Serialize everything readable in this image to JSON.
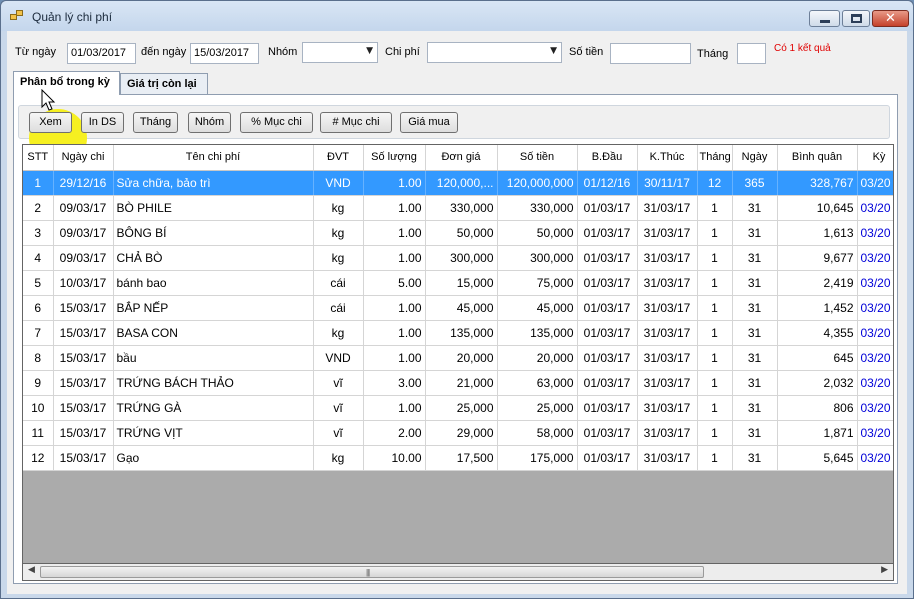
{
  "window": {
    "title": "Quản lý chi phí"
  },
  "filters": {
    "from_label": "Từ ngày",
    "from_value": "01/03/2017",
    "to_label": "đến ngày",
    "to_value": "15/03/2017",
    "group_label": "Nhóm",
    "group_value": "",
    "expense_label": "Chi phí",
    "expense_value": "",
    "amount_label": "Số tiền",
    "amount_value": "",
    "month_label": "Tháng",
    "month_value": "",
    "result_note": "Có 1 kết quả"
  },
  "tabs": [
    "Phân bổ trong kỳ",
    "Giá trị còn lại"
  ],
  "toolbar": {
    "view": "Xem",
    "print_list": "In DS",
    "month": "Tháng",
    "group": "Nhóm",
    "pct_category": "% Mục chi",
    "num_category": "# Mục chi",
    "purchase_price": "Giá mua"
  },
  "grid": {
    "columns": [
      "STT",
      "Ngày chi",
      "Tên chi phí",
      "ĐVT",
      "Số lượng",
      "Đơn giá",
      "Số tiền",
      "B.Đầu",
      "K.Thúc",
      "Tháng",
      "Ngày",
      "Bình quân",
      "Kỳ"
    ],
    "rows": [
      [
        "1",
        "29/12/16",
        "Sửa chữa, bảo trì",
        "VND",
        "1.00",
        "120,000,...",
        "120,000,000",
        "01/12/16",
        "30/11/17",
        "12",
        "365",
        "328,767",
        "03/20"
      ],
      [
        "2",
        "09/03/17",
        "BÒ PHILE",
        "kg",
        "1.00",
        "330,000",
        "330,000",
        "01/03/17",
        "31/03/17",
        "1",
        "31",
        "10,645",
        "03/20"
      ],
      [
        "3",
        "09/03/17",
        "BÔNG BÍ",
        "kg",
        "1.00",
        "50,000",
        "50,000",
        "01/03/17",
        "31/03/17",
        "1",
        "31",
        "1,613",
        "03/20"
      ],
      [
        "4",
        "09/03/17",
        "CHẢ BÒ",
        "kg",
        "1.00",
        "300,000",
        "300,000",
        "01/03/17",
        "31/03/17",
        "1",
        "31",
        "9,677",
        "03/20"
      ],
      [
        "5",
        "10/03/17",
        "bánh bao",
        "cái",
        "5.00",
        "15,000",
        "75,000",
        "01/03/17",
        "31/03/17",
        "1",
        "31",
        "2,419",
        "03/20"
      ],
      [
        "6",
        "15/03/17",
        "BẮP NẾP",
        "cái",
        "1.00",
        "45,000",
        "45,000",
        "01/03/17",
        "31/03/17",
        "1",
        "31",
        "1,452",
        "03/20"
      ],
      [
        "7",
        "15/03/17",
        "BASA CON",
        "kg",
        "1.00",
        "135,000",
        "135,000",
        "01/03/17",
        "31/03/17",
        "1",
        "31",
        "4,355",
        "03/20"
      ],
      [
        "8",
        "15/03/17",
        "bầu",
        "VND",
        "1.00",
        "20,000",
        "20,000",
        "01/03/17",
        "31/03/17",
        "1",
        "31",
        "645",
        "03/20"
      ],
      [
        "9",
        "15/03/17",
        "TRỨNG BÁCH THẢO",
        "vĩ",
        "3.00",
        "21,000",
        "63,000",
        "01/03/17",
        "31/03/17",
        "1",
        "31",
        "2,032",
        "03/20"
      ],
      [
        "10",
        "15/03/17",
        "TRỨNG GÀ",
        "vĩ",
        "1.00",
        "25,000",
        "25,000",
        "01/03/17",
        "31/03/17",
        "1",
        "31",
        "806",
        "03/20"
      ],
      [
        "11",
        "15/03/17",
        "TRỨNG VỊT",
        "vĩ",
        "2.00",
        "29,000",
        "58,000",
        "01/03/17",
        "31/03/17",
        "1",
        "31",
        "1,871",
        "03/20"
      ],
      [
        "12",
        "15/03/17",
        "Gạo",
        "kg",
        "10.00",
        "17,500",
        "175,000",
        "01/03/17",
        "31/03/17",
        "1",
        "31",
        "5,645",
        "03/20"
      ]
    ],
    "selected_row": 0
  }
}
